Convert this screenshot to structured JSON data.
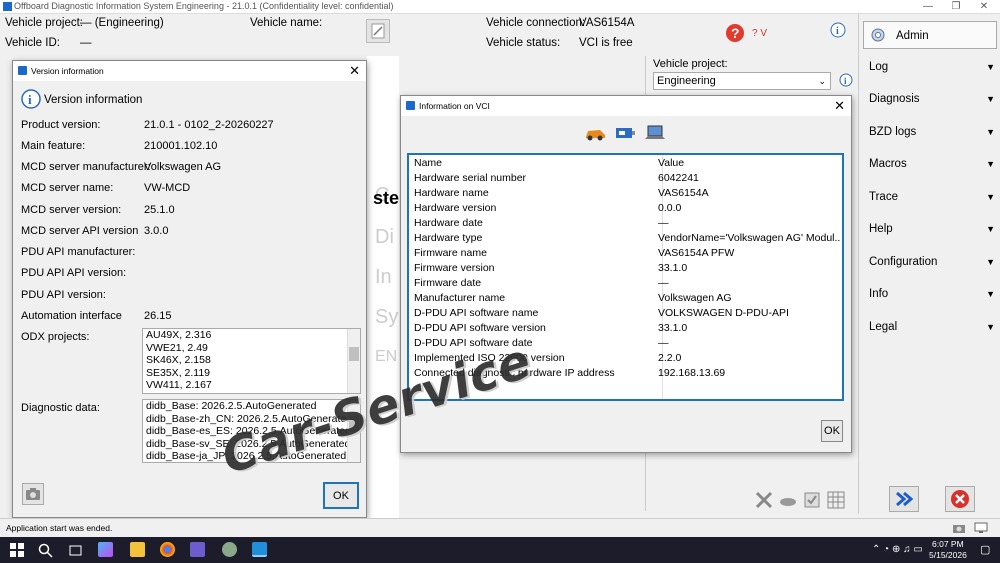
{
  "app": {
    "title": "Offboard Diagnostic Information System Engineering - 21.0.1 (Confidentiality level: confidential)"
  },
  "header": {
    "vehicle_project_label": "Vehicle project:",
    "vehicle_project_value": "—  (Engineering)",
    "vehicle_name_label": "Vehicle name:",
    "vehicle_id_label": "Vehicle ID:",
    "vehicle_id_value": "—",
    "vehicle_connection_label": "Vehicle connection:",
    "vehicle_connection_value": "VAS6154A",
    "vehicle_status_label": "Vehicle status:",
    "vehicle_status_value": "VCI is free",
    "help_label": "? V"
  },
  "sidebar": {
    "admin": "Admin",
    "items": [
      {
        "label": "Log"
      },
      {
        "label": "Diagnosis"
      },
      {
        "label": "BZD logs"
      },
      {
        "label": "Macros"
      },
      {
        "label": "Trace"
      },
      {
        "label": "Help"
      },
      {
        "label": "Configuration"
      },
      {
        "label": "Info"
      },
      {
        "label": "Legal"
      }
    ]
  },
  "project_panel": {
    "label": "Vehicle project:",
    "selected": "Engineering"
  },
  "version_window": {
    "title": "Version information",
    "heading": "Version information",
    "fields": [
      {
        "label": "Product version:",
        "value": "21.0.1  -  0102_2-20260227"
      },
      {
        "label": "Main feature:",
        "value": "210001.102.10"
      },
      {
        "label": "MCD server manufacturer:",
        "value": "Volkswagen AG"
      },
      {
        "label": "MCD server name:",
        "value": "VW-MCD"
      },
      {
        "label": "MCD server version:",
        "value": "25.1.0"
      },
      {
        "label": "MCD server API version",
        "value": "3.0.0"
      },
      {
        "label": "PDU API manufacturer:",
        "value": ""
      },
      {
        "label": "PDU API API version:",
        "value": ""
      },
      {
        "label": "PDU API version:",
        "value": ""
      },
      {
        "label": "Automation interface",
        "value": "26.15"
      }
    ],
    "odx_label": "ODX projects:",
    "odx_projects": [
      "AU49X, 2.316",
      "VWE21, 2.49",
      "SK46X, 2.158",
      "SE35X, 2.119",
      "VW411, 2.167"
    ],
    "diag_label": "Diagnostic data:",
    "diag_data": [
      "didb_Base: 2026.2.5.AutoGenerated",
      "didb_Base-zh_CN: 2026.2.5.AutoGenerated",
      "didb_Base-es_ES: 2026.2.5.AutoGenerated",
      "didb_Base-sv_SE: 2026.2.5.AutoGenerated",
      "didb_Base-ja_JP: 2026.2.5.AutoGenerated"
    ],
    "ok_label": "OK"
  },
  "vci_window": {
    "title": "Information on VCI",
    "col_name": "Name",
    "col_value": "Value",
    "rows": [
      {
        "name": "Hardware serial number",
        "value": "6042241"
      },
      {
        "name": "Hardware name",
        "value": "VAS6154A"
      },
      {
        "name": "Hardware version",
        "value": "0.0.0"
      },
      {
        "name": "Hardware date",
        "value": "—"
      },
      {
        "name": "Hardware type",
        "value": "VendorName='Volkswagen AG' Modul..."
      },
      {
        "name": "Firmware name",
        "value": "VAS6154A PFW"
      },
      {
        "name": "Firmware version",
        "value": "33.1.0"
      },
      {
        "name": "Firmware date",
        "value": "—"
      },
      {
        "name": "Manufacturer name",
        "value": "Volkswagen AG"
      },
      {
        "name": "D-PDU API software name",
        "value": "VOLKSWAGEN D-PDU-API"
      },
      {
        "name": "D-PDU API software version",
        "value": "33.1.0"
      },
      {
        "name": "D-PDU API software date",
        "value": "—"
      },
      {
        "name": "Implemented ISO 22900 version",
        "value": "2.2.0"
      },
      {
        "name": "Connected diagnostic hardware IP address",
        "value": "192.168.13.69"
      }
    ],
    "ok_label": "OK"
  },
  "background_text": {
    "a": "ste",
    "b": "Di",
    "c": "In",
    "d": "Sy",
    "e": "EN",
    "f": "C"
  },
  "status": {
    "message": "Application start was ended."
  },
  "taskbar": {
    "time": "6:07 PM",
    "date": "5/15/2026"
  },
  "watermark": "Car-Service",
  "colors": {
    "accent": "#1e74b8",
    "taskbar": "#1c1c2b"
  }
}
